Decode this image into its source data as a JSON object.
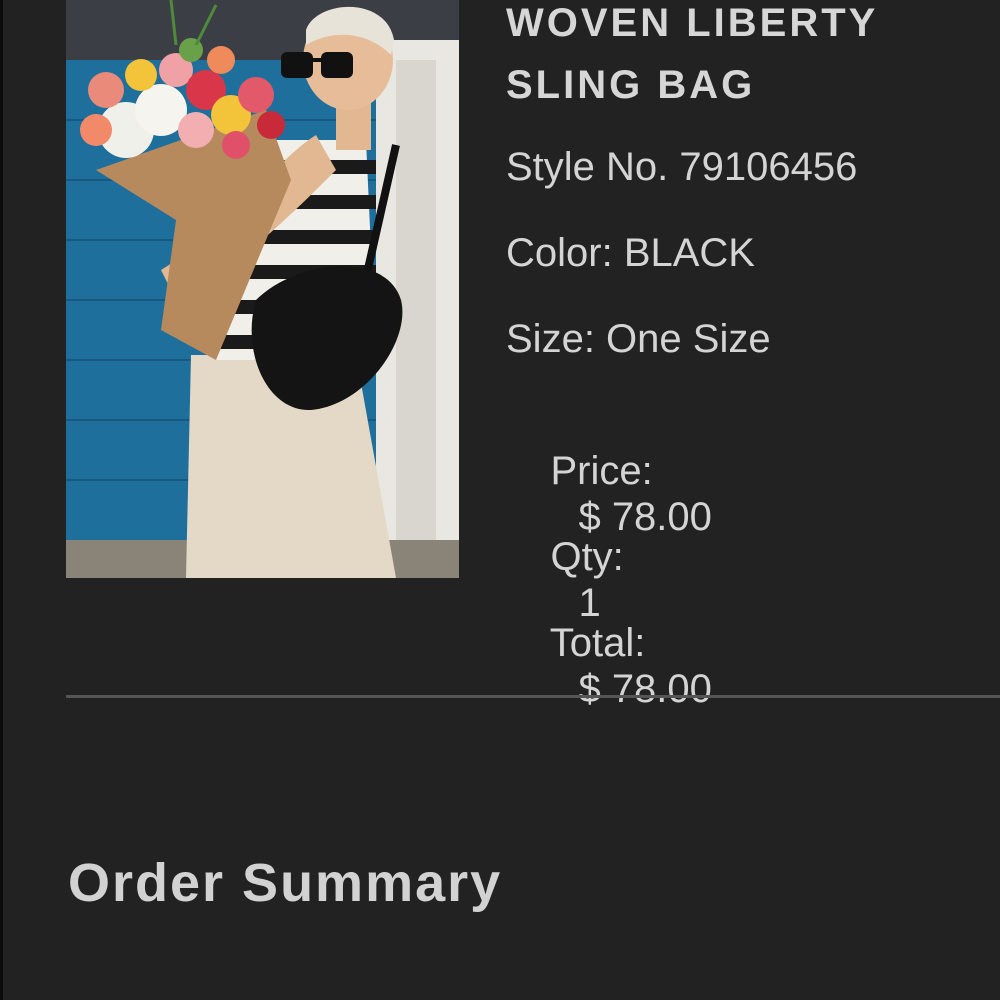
{
  "product": {
    "name": "WOVEN LIBERTY\nSLING BAG",
    "image_alt": "Model holding a flower bouquet wearing a black woven sling bag"
  },
  "details": {
    "style": "Style No. 79106456",
    "color": "Color: BLACK",
    "size": "Size: One Size",
    "price_label": "Price:",
    "price_value": "$ 78.00",
    "qty_label": "Qty:",
    "qty_value": "1",
    "total_label": "Total:",
    "total_value": "$ 78.00"
  },
  "summary": {
    "title": "Order Summary"
  },
  "colors": {
    "background": "#222222",
    "text": "#d4d4d4",
    "divider": "#555555"
  }
}
